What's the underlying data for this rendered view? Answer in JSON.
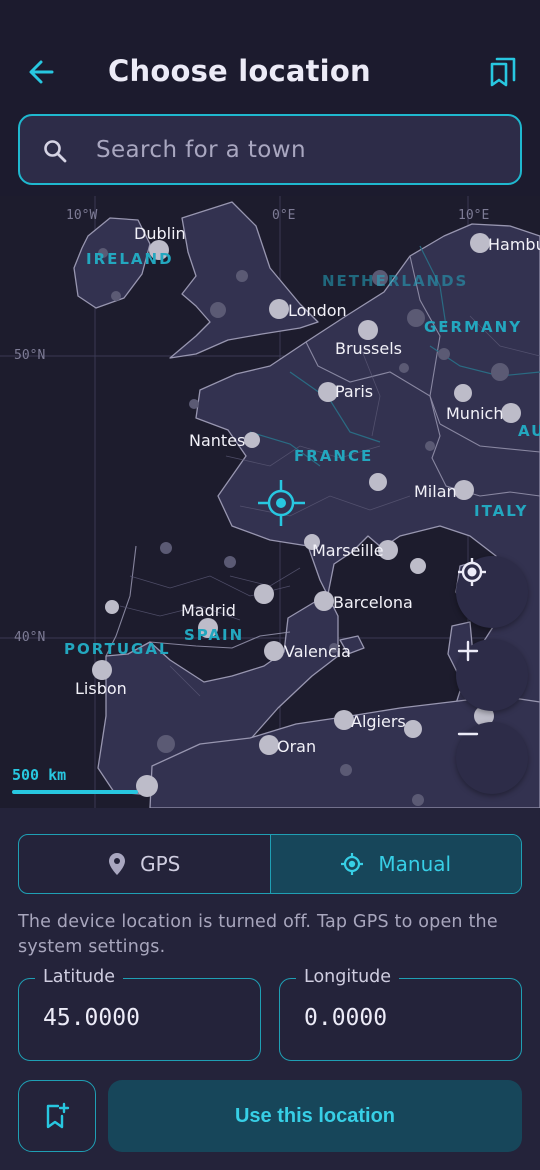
{
  "header": {
    "title": "Choose location",
    "back_icon": "arrow-back-icon",
    "bookmarks_icon": "bookmarks-icon"
  },
  "search": {
    "placeholder": "Search for a town"
  },
  "map": {
    "graticule_labels": [
      "10°W",
      "0°E",
      "10°E",
      "50°N",
      "40°N"
    ],
    "cities": [
      "Dublin",
      "London",
      "Brussels",
      "Paris",
      "Nantes",
      "Munich",
      "Milan",
      "Marseille",
      "Madrid",
      "Barcelona",
      "Valencia",
      "Lisbon",
      "Algiers",
      "Oran",
      "Hambu"
    ],
    "countries": [
      "IRELAND",
      "NETHERLANDS",
      "GERMANY",
      "FRANCE",
      "ITALY",
      "SPAIN",
      "PORTUGAL",
      "AU"
    ],
    "scale_label": "500 km"
  },
  "mode_toggle": {
    "gps_label": "GPS",
    "manual_label": "Manual",
    "selected": "Manual"
  },
  "note": "The device location is turned off. Tap GPS to open the system settings.",
  "fields": {
    "latitude_label": "Latitude",
    "latitude_value": "45.0000",
    "longitude_label": "Longitude",
    "longitude_value": "0.0000"
  },
  "actions": {
    "use_label": "Use this location"
  },
  "colors": {
    "accent": "#28c7e0",
    "background": "#1c1b2e",
    "land": "#333250",
    "panel": "#24233a"
  }
}
